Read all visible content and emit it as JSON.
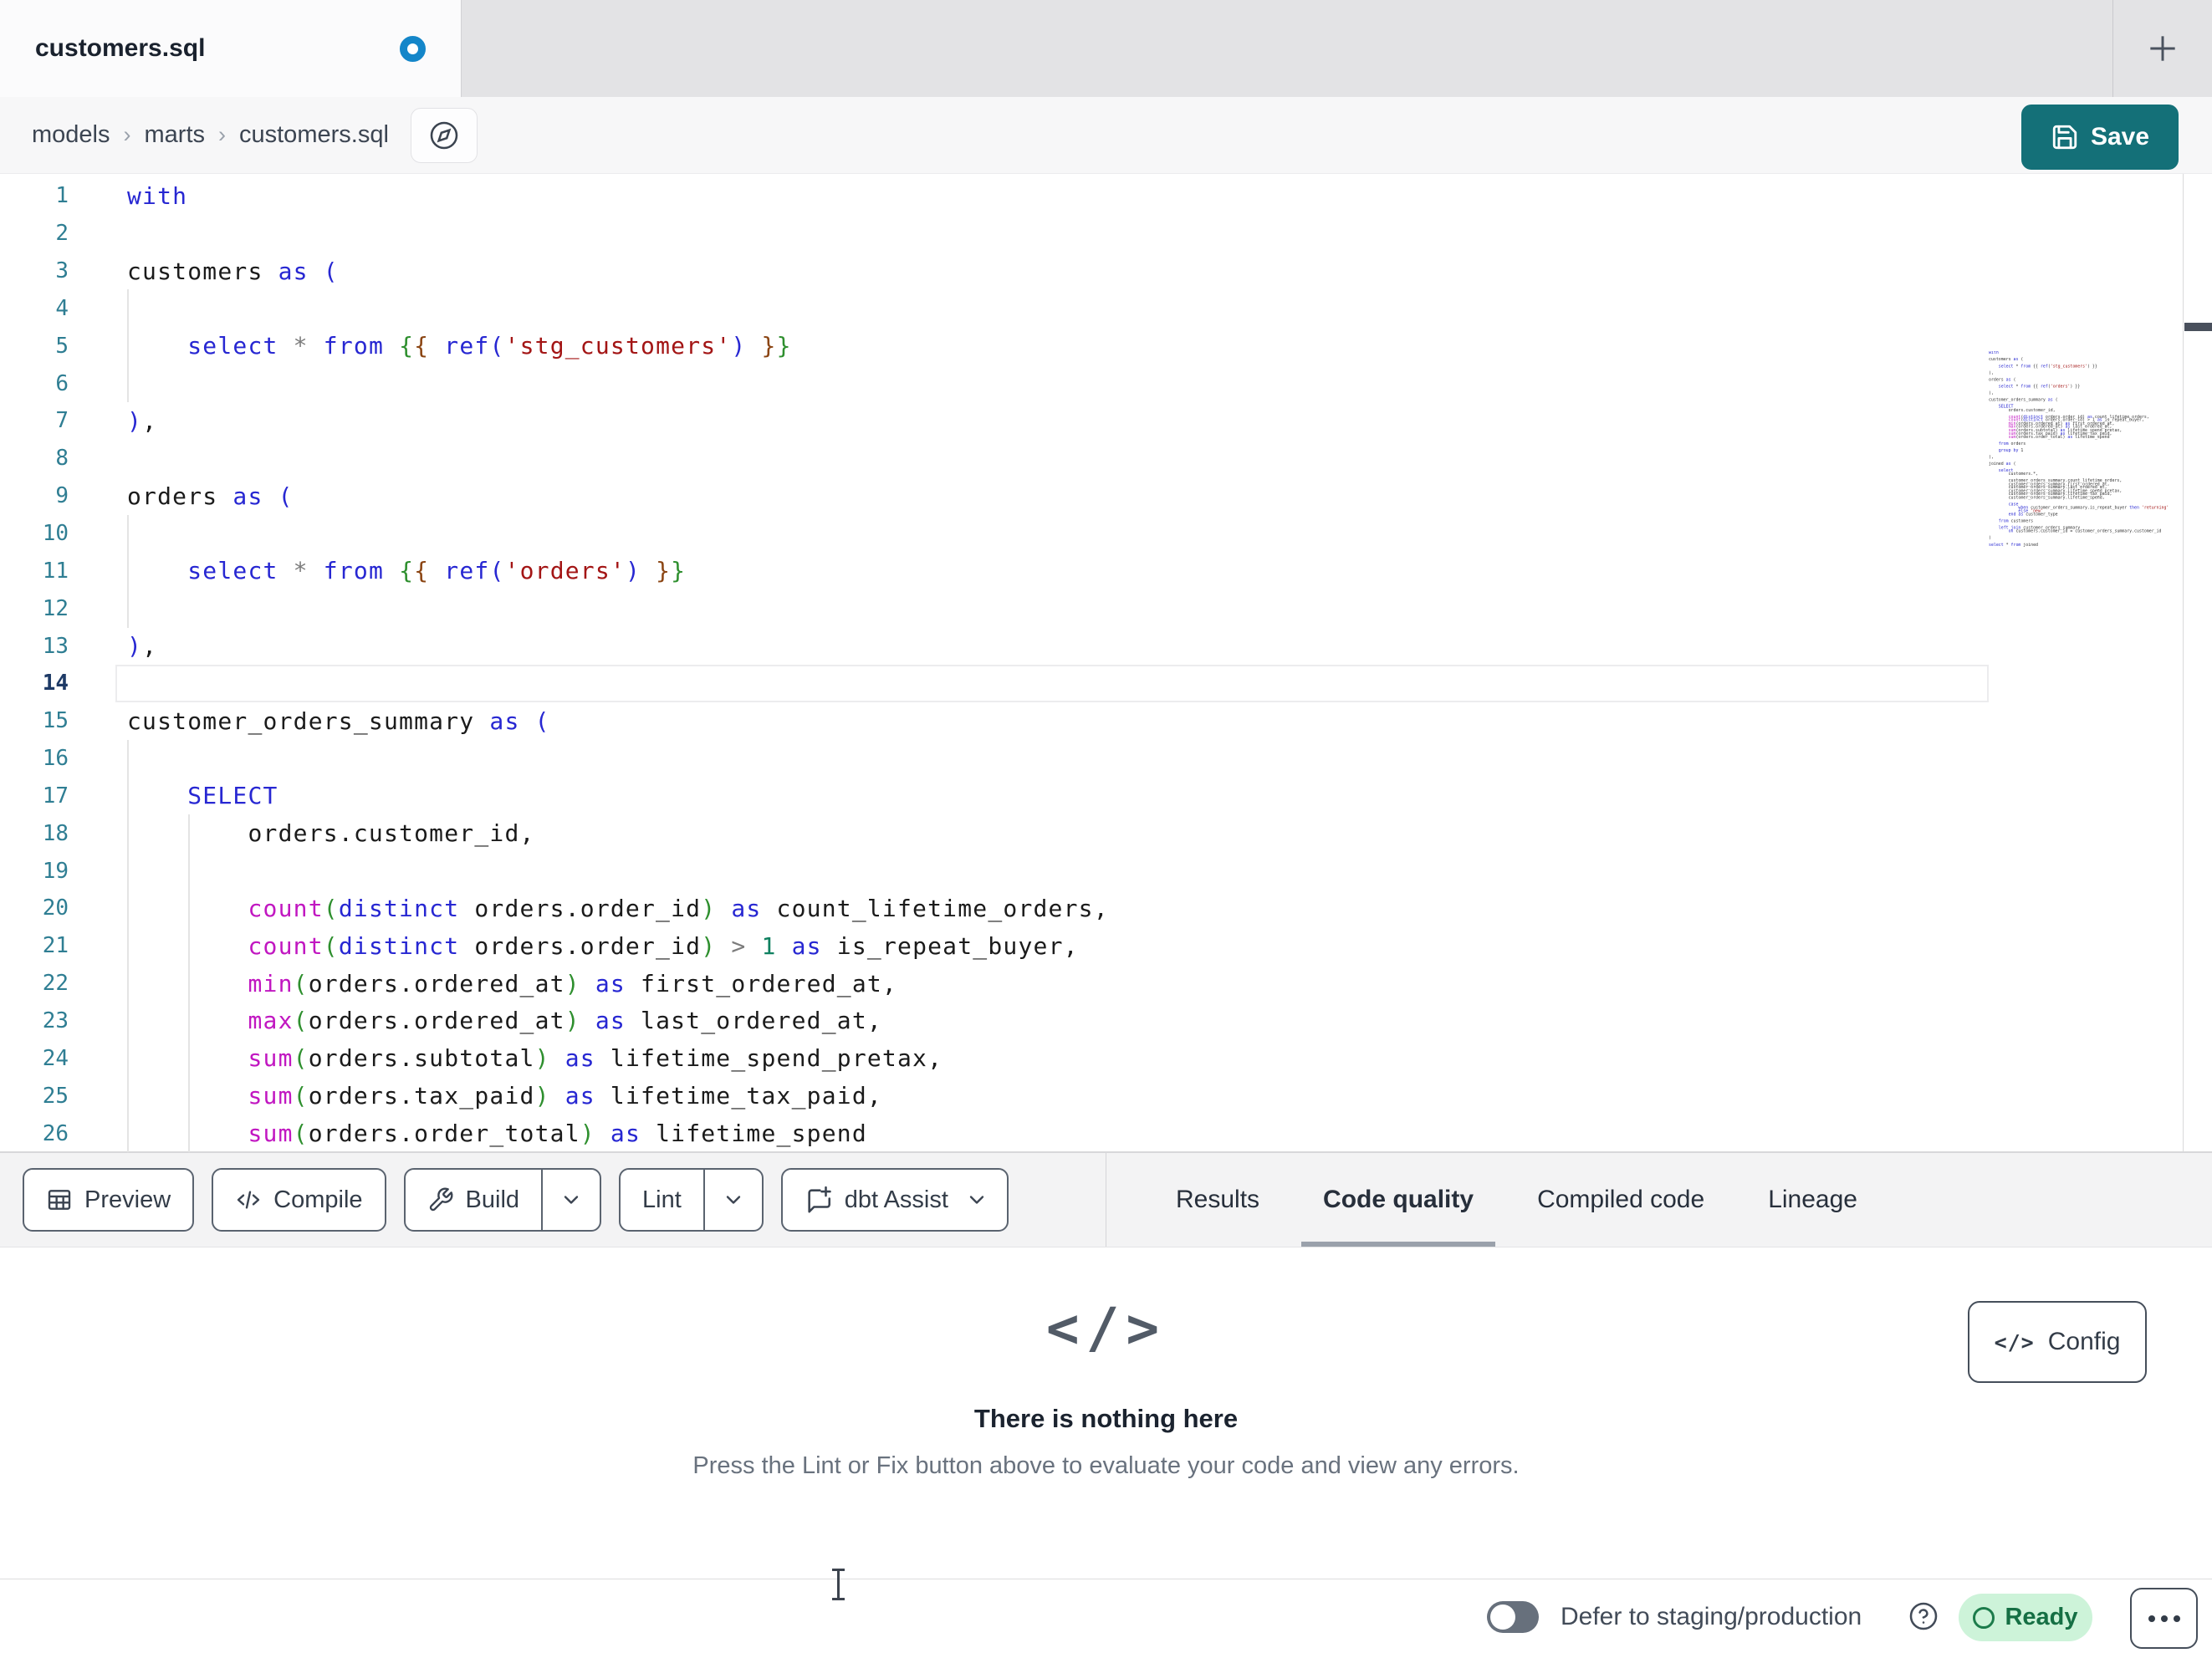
{
  "tab_bar": {
    "active_tab_title": "customers.sql",
    "modified": true,
    "new_tab_icon": "plus-icon"
  },
  "breadcrumb": {
    "items": [
      "models",
      "marts",
      "customers.sql"
    ],
    "separator": "›",
    "explore_icon": "compass-icon"
  },
  "header": {
    "save_label": "Save",
    "save_icon": "floppy-disk-icon",
    "save_color": "#147078"
  },
  "editor": {
    "active_line": 14,
    "lines": [
      {
        "n": 1,
        "tokens": [
          [
            "kw",
            "with"
          ]
        ]
      },
      {
        "n": 2,
        "tokens": []
      },
      {
        "n": 3,
        "tokens": [
          [
            "id",
            "customers "
          ],
          [
            "kw",
            "as"
          ],
          [
            "id",
            " "
          ],
          [
            "b1",
            "("
          ]
        ]
      },
      {
        "n": 4,
        "tokens": []
      },
      {
        "n": 5,
        "tokens": [
          [
            "ws",
            "    "
          ],
          [
            "kw",
            "select"
          ],
          [
            "id",
            " "
          ],
          [
            "op",
            "*"
          ],
          [
            "id",
            " "
          ],
          [
            "kw",
            "from"
          ],
          [
            "id",
            " "
          ],
          [
            "b2",
            "{"
          ],
          [
            "b3",
            "{"
          ],
          [
            "id",
            " "
          ],
          [
            "kw",
            "ref"
          ],
          [
            "b1",
            "("
          ],
          [
            "str",
            "'stg_customers'"
          ],
          [
            "b1",
            ")"
          ],
          [
            "id",
            " "
          ],
          [
            "b3",
            "}"
          ],
          [
            "b2",
            "}"
          ]
        ]
      },
      {
        "n": 6,
        "tokens": []
      },
      {
        "n": 7,
        "tokens": [
          [
            "b1",
            ")"
          ],
          [
            "id",
            ","
          ]
        ]
      },
      {
        "n": 8,
        "tokens": []
      },
      {
        "n": 9,
        "tokens": [
          [
            "id",
            "orders "
          ],
          [
            "kw",
            "as"
          ],
          [
            "id",
            " "
          ],
          [
            "b1",
            "("
          ]
        ]
      },
      {
        "n": 10,
        "tokens": []
      },
      {
        "n": 11,
        "tokens": [
          [
            "ws",
            "    "
          ],
          [
            "kw",
            "select"
          ],
          [
            "id",
            " "
          ],
          [
            "op",
            "*"
          ],
          [
            "id",
            " "
          ],
          [
            "kw",
            "from"
          ],
          [
            "id",
            " "
          ],
          [
            "b2",
            "{"
          ],
          [
            "b3",
            "{"
          ],
          [
            "id",
            " "
          ],
          [
            "kw",
            "ref"
          ],
          [
            "b1",
            "("
          ],
          [
            "str",
            "'orders'"
          ],
          [
            "b1",
            ")"
          ],
          [
            "id",
            " "
          ],
          [
            "b3",
            "}"
          ],
          [
            "b2",
            "}"
          ]
        ]
      },
      {
        "n": 12,
        "tokens": []
      },
      {
        "n": 13,
        "tokens": [
          [
            "b1",
            ")"
          ],
          [
            "id",
            ","
          ]
        ]
      },
      {
        "n": 14,
        "tokens": [],
        "active": true
      },
      {
        "n": 15,
        "tokens": [
          [
            "id",
            "customer_orders_summary "
          ],
          [
            "kw",
            "as"
          ],
          [
            "id",
            " "
          ],
          [
            "b1",
            "("
          ]
        ]
      },
      {
        "n": 16,
        "tokens": []
      },
      {
        "n": 17,
        "tokens": [
          [
            "ws",
            "    "
          ],
          [
            "kw",
            "SELECT"
          ]
        ]
      },
      {
        "n": 18,
        "tokens": [
          [
            "ws",
            "        "
          ],
          [
            "id",
            "orders.customer_id,"
          ]
        ]
      },
      {
        "n": 19,
        "tokens": []
      },
      {
        "n": 20,
        "tokens": [
          [
            "ws",
            "        "
          ],
          [
            "fn",
            "count"
          ],
          [
            "b2",
            "("
          ],
          [
            "kw",
            "distinct"
          ],
          [
            "id",
            " orders.order_id"
          ],
          [
            "b2",
            ")"
          ],
          [
            "id",
            " "
          ],
          [
            "kw",
            "as"
          ],
          [
            "id",
            " count_lifetime_orders,"
          ]
        ]
      },
      {
        "n": 21,
        "tokens": [
          [
            "ws",
            "        "
          ],
          [
            "fn",
            "count"
          ],
          [
            "b2",
            "("
          ],
          [
            "kw",
            "distinct"
          ],
          [
            "id",
            " orders.order_id"
          ],
          [
            "b2",
            ")"
          ],
          [
            "id",
            " "
          ],
          [
            "op",
            ">"
          ],
          [
            "id",
            " "
          ],
          [
            "num",
            "1"
          ],
          [
            "id",
            " "
          ],
          [
            "kw",
            "as"
          ],
          [
            "id",
            " is_repeat_buyer,"
          ]
        ]
      },
      {
        "n": 22,
        "tokens": [
          [
            "ws",
            "        "
          ],
          [
            "fn",
            "min"
          ],
          [
            "b2",
            "("
          ],
          [
            "id",
            "orders.ordered_at"
          ],
          [
            "b2",
            ")"
          ],
          [
            "id",
            " "
          ],
          [
            "kw",
            "as"
          ],
          [
            "id",
            " first_ordered_at,"
          ]
        ]
      },
      {
        "n": 23,
        "tokens": [
          [
            "ws",
            "        "
          ],
          [
            "fn",
            "max"
          ],
          [
            "b2",
            "("
          ],
          [
            "id",
            "orders.ordered_at"
          ],
          [
            "b2",
            ")"
          ],
          [
            "id",
            " "
          ],
          [
            "kw",
            "as"
          ],
          [
            "id",
            " last_ordered_at,"
          ]
        ]
      },
      {
        "n": 24,
        "tokens": [
          [
            "ws",
            "        "
          ],
          [
            "fn",
            "sum"
          ],
          [
            "b2",
            "("
          ],
          [
            "id",
            "orders.subtotal"
          ],
          [
            "b2",
            ")"
          ],
          [
            "id",
            " "
          ],
          [
            "kw",
            "as"
          ],
          [
            "id",
            " lifetime_spend_pretax,"
          ]
        ]
      },
      {
        "n": 25,
        "tokens": [
          [
            "ws",
            "        "
          ],
          [
            "fn",
            "sum"
          ],
          [
            "b2",
            "("
          ],
          [
            "id",
            "orders.tax_paid"
          ],
          [
            "b2",
            ")"
          ],
          [
            "id",
            " "
          ],
          [
            "kw",
            "as"
          ],
          [
            "id",
            " lifetime_tax_paid,"
          ]
        ]
      },
      {
        "n": 26,
        "tokens": [
          [
            "ws",
            "        "
          ],
          [
            "fn",
            "sum"
          ],
          [
            "b2",
            "("
          ],
          [
            "id",
            "orders.order_total"
          ],
          [
            "b2",
            ")"
          ],
          [
            "id",
            " "
          ],
          [
            "kw",
            "as"
          ],
          [
            "id",
            " lifetime_spend"
          ]
        ]
      }
    ],
    "minimap_lines": [
      "with",
      "",
      "customers as (",
      "",
      "    select * from {{ ref('stg_customers') }}",
      "",
      "),",
      "",
      "orders as (",
      "",
      "    select * from {{ ref('orders') }}",
      "",
      "),",
      "",
      "customer_orders_summary as (",
      "",
      "    SELECT",
      "        orders.customer_id,",
      "",
      "        count(distinct orders.order_id) as count_lifetime_orders,",
      "        count(distinct orders.order_id) > 1 as is_repeat_buyer,",
      "        min(orders.ordered_at) as first_ordered_at,",
      "        max(orders.ordered_at) as last_ordered_at,",
      "        sum(orders.subtotal) as lifetime_spend_pretax,",
      "        sum(orders.tax_paid) as lifetime_tax_paid,",
      "        sum(orders.order_total) as lifetime_spend",
      "",
      "    from orders",
      "",
      "    group by 1",
      "",
      "),",
      "",
      "joined as (",
      "",
      "    select",
      "        customers.*,",
      "",
      "        customer_orders_summary.count_lifetime_orders,",
      "        customer_orders_summary.first_ordered_at,",
      "        customer_orders_summary.last_ordered_at,",
      "        customer_orders_summary.lifetime_spend_pretax,",
      "        customer_orders_summary.lifetime_tax_paid,",
      "        customer_orders_summary.lifetime_spend,",
      "",
      "        case",
      "            when customer_orders_summary.is_repeat_buyer then 'returning'",
      "            else 'new'",
      "        end as customer_type",
      "",
      "    from customers",
      "",
      "    left join customer_orders_summary",
      "        on customers.customer_id = customer_orders_summary.customer_id",
      "",
      ")",
      "",
      "select * from joined"
    ]
  },
  "toolbar": {
    "preview_label": "Preview",
    "compile_label": "Compile",
    "build_label": "Build",
    "lint_label": "Lint",
    "assist_label": "dbt Assist"
  },
  "panel_tabs": {
    "results_label": "Results",
    "code_quality_label": "Code quality",
    "compiled_code_label": "Compiled code",
    "lineage_label": "Lineage",
    "active": "Code quality"
  },
  "results_panel": {
    "config_label": "Config",
    "config_icon_text": "</>",
    "empty_icon_text": "</>",
    "empty_title": "There is nothing here",
    "empty_description": "Press the Lint or Fix button above to evaluate your code and view any errors."
  },
  "status_bar": {
    "defer_toggle_on": false,
    "defer_label": "Defer to staging/production",
    "ready_label": "Ready"
  },
  "colors": {
    "accent_teal": "#147078",
    "modified_dot_blue": "#1486c9",
    "ready_badge_bg": "#cdf3d9",
    "ready_badge_text": "#156f44",
    "keyword_blue": "#2727d2",
    "function_magenta": "#c117c1",
    "string_red": "#a31515",
    "tab_strip_gray": "#e3e3e5"
  }
}
